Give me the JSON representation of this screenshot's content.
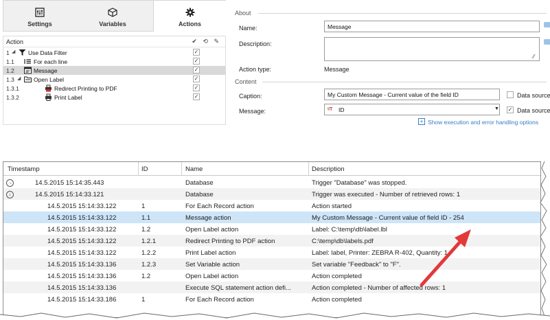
{
  "tabs": [
    {
      "label": "Settings",
      "icon": "settings-icon"
    },
    {
      "label": "Variables",
      "icon": "cube-icon"
    },
    {
      "label": "Actions",
      "icon": "gear-icon"
    }
  ],
  "tree": {
    "header": "Action",
    "header_icons": "✔ ⟲ ✎",
    "rows": [
      {
        "num": "1",
        "label": "Use Data Filter",
        "icon": "filter-icon",
        "checked": true
      },
      {
        "num": "1.1",
        "label": "For each line",
        "icon": "list-icon",
        "checked": true
      },
      {
        "num": "1.2",
        "label": "Message",
        "icon": "message-icon",
        "checked": true
      },
      {
        "num": "1.3",
        "label": "Open Label",
        "icon": "folder-icon",
        "checked": true
      },
      {
        "num": "1.3.1",
        "label": "Redirect Printing to PDF",
        "icon": "printer-pdf-icon",
        "checked": true
      },
      {
        "num": "1.3.2",
        "label": "Print Label",
        "icon": "printer-icon",
        "checked": true
      }
    ]
  },
  "about": {
    "section": "About",
    "name_label": "Name:",
    "name_value": "Message",
    "description_label": "Description:",
    "description_value": "",
    "action_type_label": "Action type:",
    "action_type_value": "Message"
  },
  "content": {
    "section": "Content",
    "caption_label": "Caption:",
    "caption_value": "My Custom Message - Current value of the field ID",
    "caption_data_source": "Data source",
    "message_label": "Message:",
    "message_value": "ID",
    "message_data_source": "Data source",
    "link": "Show execution and error handling options"
  },
  "log": {
    "columns": [
      "Timestamp",
      "ID",
      "Name",
      "Description"
    ],
    "rows": [
      {
        "timestamp": "14.5.2015 15:14:35.443",
        "id": "",
        "name": "Database",
        "description": "Trigger \"Database\" was stopped.",
        "level": 0,
        "expander": "→"
      },
      {
        "timestamp": "14.5.2015 15:14:33.121",
        "id": "",
        "name": "Database",
        "description": "Trigger was executed - Number of retrieved rows: 1",
        "level": 0,
        "expander": "↓"
      },
      {
        "timestamp": "14.5.2015 15:14:33.122",
        "id": "1",
        "name": "For Each Record action",
        "description": "Action started",
        "level": 1
      },
      {
        "timestamp": "14.5.2015 15:14:33.122",
        "id": "1.1",
        "name": "Message action",
        "description": "My Custom Message - Current value of field ID - 254",
        "level": 1,
        "selected": true
      },
      {
        "timestamp": "14.5.2015 15:14:33.122",
        "id": "1.2",
        "name": "Open Label action",
        "description": "Label: C:\\temp\\db\\label.lbl",
        "level": 1
      },
      {
        "timestamp": "14.5.2015 15:14:33.122",
        "id": "1.2.1",
        "name": "Redirect Printing to PDF action",
        "description": "C:\\temp\\db\\labels.pdf",
        "level": 1
      },
      {
        "timestamp": "14.5.2015 15:14:33.122",
        "id": "1.2.2",
        "name": "Print Label action",
        "description": "Label: label, Printer: ZEBRA R-402, Quantity: 1",
        "level": 1
      },
      {
        "timestamp": "14.5.2015 15:14:33.136",
        "id": "1.2.3",
        "name": "Set Variable action",
        "description": "Set variable \"Feedback\" to \"F\".",
        "level": 1
      },
      {
        "timestamp": "14.5.2015 15:14:33.136",
        "id": "1.2",
        "name": "Open Label action",
        "description": "Action completed",
        "level": 1
      },
      {
        "timestamp": "14.5.2015 15:14:33.136",
        "id": "",
        "name": "Execute SQL statement action defi...",
        "description": "Action completed - Number of affected rows: 1",
        "level": 1
      },
      {
        "timestamp": "14.5.2015 15:14:33.186",
        "id": "1",
        "name": "For Each Record action",
        "description": "Action completed",
        "level": 1
      }
    ]
  },
  "colors": {
    "accent": "#3a7cc6",
    "selected_row": "#cde5f7",
    "arrow": "#e2393b"
  }
}
